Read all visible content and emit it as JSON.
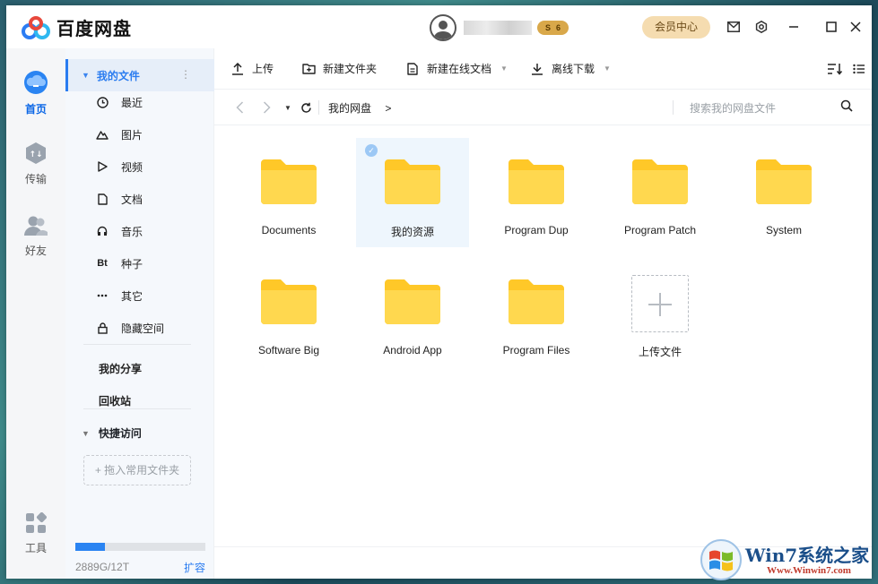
{
  "app": {
    "name": "百度网盘",
    "vip_level_prefix": "S",
    "vip_level": "6",
    "member_center": "会员中心"
  },
  "rail": {
    "items": [
      {
        "label": "首页",
        "icon": "cloud-icon",
        "active": true
      },
      {
        "label": "传输",
        "icon": "transfer-icon",
        "active": false
      },
      {
        "label": "好友",
        "icon": "friends-icon",
        "active": false
      },
      {
        "label": "工具",
        "icon": "tools-icon",
        "active": false
      }
    ]
  },
  "sidebar": {
    "my_files": "我的文件",
    "categories": [
      {
        "label": "最近",
        "icon": "clock-icon"
      },
      {
        "label": "图片",
        "icon": "mountain-icon"
      },
      {
        "label": "视频",
        "icon": "play-icon"
      },
      {
        "label": "文档",
        "icon": "document-icon"
      },
      {
        "label": "音乐",
        "icon": "headphones-icon"
      },
      {
        "label": "种子",
        "icon": "bt-icon",
        "glyph": "Bt"
      },
      {
        "label": "其它",
        "icon": "more-dots-icon"
      },
      {
        "label": "隐藏空间",
        "icon": "lock-icon"
      }
    ],
    "my_share": "我的分享",
    "recycle_bin": "回收站",
    "quick_access": "快捷访问",
    "drop_hint": "+ 拖入常用文件夹",
    "quota_text": "2889G/12T",
    "quota_fraction": 0.23,
    "expand": "扩容"
  },
  "toolbar": {
    "upload": "上传",
    "new_folder": "新建文件夹",
    "new_online_doc": "新建在线文档",
    "offline_download": "离线下载"
  },
  "pathbar": {
    "crumb": "我的网盘",
    "crumb_sep": ">",
    "search_placeholder": "搜索我的网盘文件"
  },
  "files": [
    {
      "name": "Documents",
      "selected": false
    },
    {
      "name": "我的资源",
      "selected": true
    },
    {
      "name": "Program Dup",
      "selected": false
    },
    {
      "name": "Program Patch",
      "selected": false
    },
    {
      "name": "System",
      "selected": false
    },
    {
      "name": "Software Big",
      "selected": false
    },
    {
      "name": "Android App",
      "selected": false
    },
    {
      "name": "Program Files",
      "selected": false
    }
  ],
  "upload_tile": {
    "label": "上传文件"
  },
  "watermark": {
    "brand": "Win7系统之家",
    "url": "Www.Winwin7.com"
  },
  "colors": {
    "accent": "#2a7cf0",
    "folder": "#ffd443",
    "member_bg": "#f5dcb0"
  }
}
